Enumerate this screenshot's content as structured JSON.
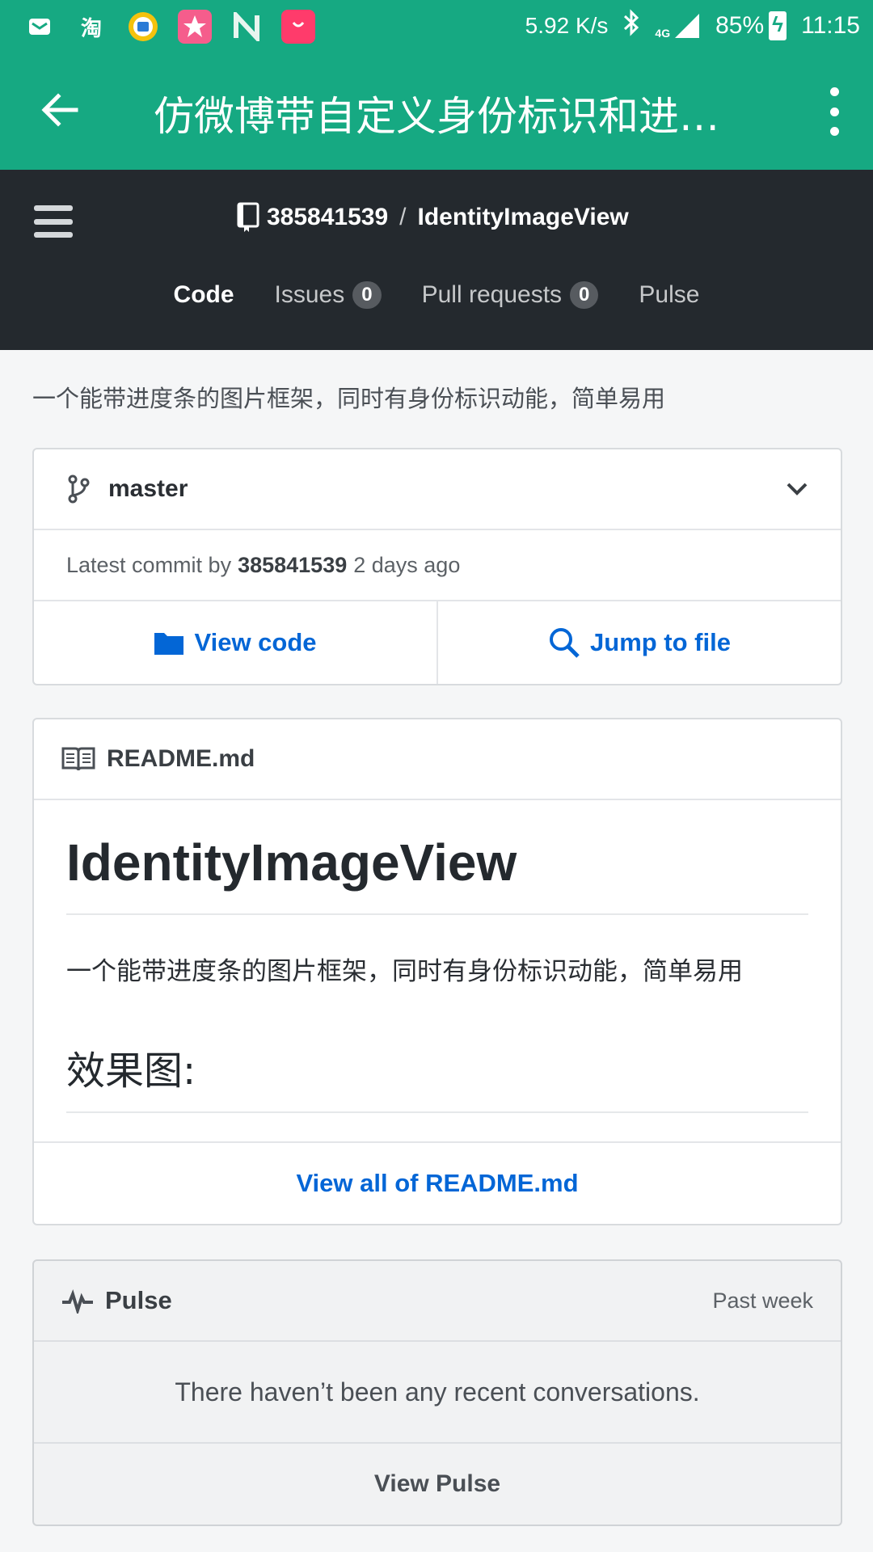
{
  "status_bar": {
    "icons_left": [
      "mail-icon",
      "taobao-icon",
      "book-app-icon",
      "star-app-icon",
      "n-app-icon",
      "shopping-bag-icon"
    ],
    "taobao_glyph": "淘",
    "net_speed": "5.92 K/s",
    "network": "4G",
    "battery": "85%",
    "time": "11:15"
  },
  "app_bar": {
    "title": "仿微博带自定义身份标识和进度条的图片框架"
  },
  "github_header": {
    "owner": "385841539",
    "separator": "/",
    "repo": "IdentityImageView",
    "tabs": [
      {
        "label": "Code"
      },
      {
        "label": "Issues",
        "count": "0"
      },
      {
        "label": "Pull requests",
        "count": "0"
      },
      {
        "label": "Pulse"
      }
    ]
  },
  "description": "一个能带进度条的图片框架，同时有身份标识动能，简单易用",
  "branch_card": {
    "branch": "master",
    "commit_prefix": "Latest commit by",
    "commit_author": "385841539",
    "commit_time": "2 days ago",
    "view_code": "View code",
    "jump_to_file": "Jump to file"
  },
  "readme_card": {
    "filename": "README.md",
    "h1": "IdentityImageView",
    "paragraph": "一个能带进度条的图片框架，同时有身份标识动能，简单易用",
    "h2": "效果图:",
    "view_all": "View all of README.md"
  },
  "pulse_card": {
    "title": "Pulse",
    "period": "Past week",
    "empty_message": "There haven’t been any recent conversations.",
    "view_pulse": "View Pulse"
  },
  "colors": {
    "app_bar": "#16a982",
    "github_header": "#24292e",
    "link": "#0366d6"
  }
}
